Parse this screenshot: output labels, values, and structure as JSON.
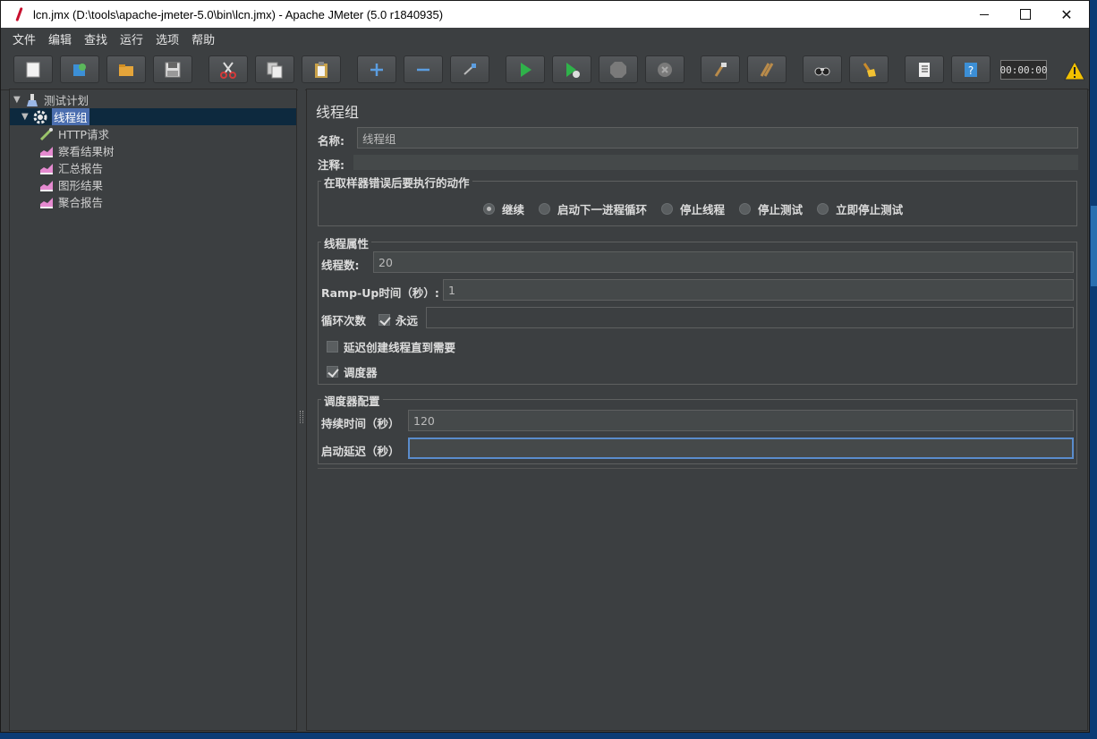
{
  "window": {
    "title": "lcn.jmx (D:\\tools\\apache-jmeter-5.0\\bin\\lcn.jmx) - Apache JMeter (5.0 r1840935)"
  },
  "menubar": {
    "items": [
      "文件",
      "编辑",
      "查找",
      "运行",
      "选项",
      "帮助"
    ]
  },
  "toolbar": {
    "timer": "00:00:00",
    "buttons": [
      "new-icon",
      "templates-icon",
      "open-icon",
      "save-icon",
      "cut-icon",
      "copy-icon",
      "paste-icon",
      "expand-icon",
      "collapse-icon",
      "toggle-icon",
      "start-icon",
      "start-no-pause-icon",
      "stop-icon",
      "shutdown-icon",
      "clear-icon",
      "clear-all-icon",
      "search-icon",
      "reset-search-icon",
      "function-helper-icon",
      "help-icon"
    ]
  },
  "tree": {
    "items": [
      {
        "label": "测试计划",
        "icon": "test-plan-icon",
        "level": 0,
        "expanded": true
      },
      {
        "label": "线程组",
        "icon": "gear-icon",
        "level": 1,
        "expanded": true,
        "selected": true
      },
      {
        "label": "HTTP请求",
        "icon": "pipette-icon",
        "level": 2
      },
      {
        "label": "察看结果树",
        "icon": "listener-icon",
        "level": 2
      },
      {
        "label": "汇总报告",
        "icon": "listener-icon",
        "level": 2
      },
      {
        "label": "图形结果",
        "icon": "listener-icon",
        "level": 2
      },
      {
        "label": "聚合报告",
        "icon": "listener-icon",
        "level": 2
      }
    ]
  },
  "panel": {
    "title": "线程组",
    "name_label": "名称:",
    "name_value": "线程组",
    "comment_label": "注释:",
    "comment_value": "",
    "error_group_title": "在取样器错误后要执行的动作",
    "error_actions": [
      {
        "label": "继续",
        "selected": true
      },
      {
        "label": "启动下一进程循环",
        "selected": false
      },
      {
        "label": "停止线程",
        "selected": false
      },
      {
        "label": "停止测试",
        "selected": false
      },
      {
        "label": "立即停止测试",
        "selected": false
      }
    ],
    "thread_group_title": "线程属性",
    "threads_label": "线程数:",
    "threads_value": "20",
    "rampup_label": "Ramp-Up时间（秒）:",
    "rampup_value": "1",
    "loop_label": "循环次数",
    "forever_label": "永远",
    "forever_checked": true,
    "loop_value": "",
    "delay_label": "延迟创建线程直到需要",
    "delay_checked": false,
    "scheduler_label": "调度器",
    "scheduler_checked": true,
    "scheduler_group_title": "调度器配置",
    "duration_label": "持续时间（秒）",
    "duration_value": "120",
    "startup_delay_label": "启动延迟（秒）",
    "startup_delay_value": ""
  }
}
